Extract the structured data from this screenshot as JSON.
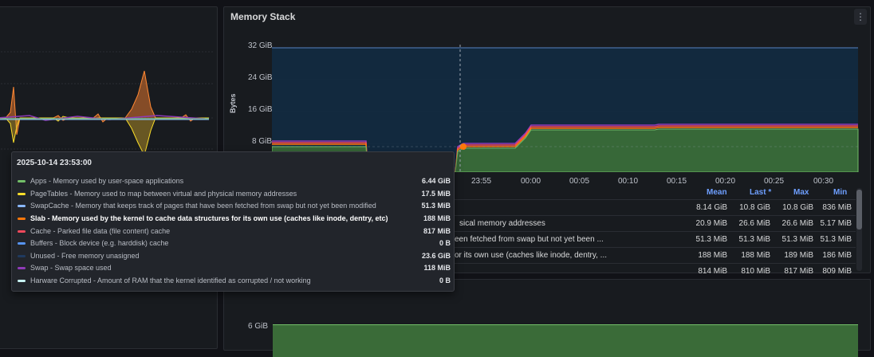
{
  "panels": {
    "memory_stack": {
      "title": "Memory Stack",
      "menu_icon": "⋮"
    }
  },
  "chart_data": {
    "type": "area",
    "ylabel": "Bytes",
    "y_ticks": [
      "32 GiB",
      "24 GiB",
      "16 GiB",
      "8 GiB"
    ],
    "x_ticks": [
      "23:55",
      "00:00",
      "00:05",
      "00:10",
      "00:15",
      "00:20",
      "00:25",
      "00:30"
    ],
    "ylim_gib": [
      0,
      32
    ],
    "legend_placement": "bottom",
    "legend_headers": [
      "Mean",
      "Last *",
      "Max",
      "Min"
    ],
    "series": [
      {
        "name": "Apps - Memory used by user-space applications",
        "color": "#73bf69"
      },
      {
        "name": "PageTables - Memory used to map between virtual and physical memory addresses",
        "color": "#fade2a"
      },
      {
        "name": "SwapCache - Memory that keeps track of pages that have been fetched from swap but not yet been modified",
        "color": "#5794f2"
      },
      {
        "name": "Slab - Memory used by the kernel to cache data structures for its own use (caches like inode, dentry, etc)",
        "color": "#ff780a"
      },
      {
        "name": "Cache - Parked file data (file content) cache",
        "color": "#f2495c"
      },
      {
        "name": "Buffers - Block device (e.g. harddisk) cache",
        "color": "#5794f2"
      },
      {
        "name": "Unused - Free memory unasigned",
        "color": "#1f3a5f"
      },
      {
        "name": "Swap - Swap space used",
        "color": "#8f3bb8"
      },
      {
        "name": "Harware Corrupted - Amount of RAM that the kernel identified as corrupted / not working",
        "color": "#c8f2f2"
      }
    ]
  },
  "legend_rows": [
    {
      "name": "",
      "mean": "8.14 GiB",
      "last": "10.8 GiB",
      "max": "10.8 GiB",
      "min": "836 MiB"
    },
    {
      "name": "sical memory addresses",
      "mean": "20.9 MiB",
      "last": "26.6 MiB",
      "max": "26.6 MiB",
      "min": "5.17 MiB"
    },
    {
      "name": "een fetched from swap but not yet been ...",
      "mean": "51.3 MiB",
      "last": "51.3 MiB",
      "max": "51.3 MiB",
      "min": "51.3 MiB"
    },
    {
      "name": "or its own use (caches like inode, dentry, ...",
      "mean": "188 MiB",
      "last": "188 MiB",
      "max": "189 MiB",
      "min": "186 MiB"
    },
    {
      "name": "",
      "mean": "814 MiB",
      "last": "810 MiB",
      "max": "817 MiB",
      "min": "809 MiB"
    }
  ],
  "lower_panel": {
    "y_tick": "6 GiB"
  },
  "tooltip": {
    "timestamp": "2025-10-14 23:53:00",
    "rows": [
      {
        "label": "Apps - Memory used by user-space applications",
        "value": "6.44 GiB",
        "color": "#73bf69"
      },
      {
        "label": "PageTables - Memory used to map between virtual and physical memory addresses",
        "value": "17.5 MiB",
        "color": "#fade2a"
      },
      {
        "label": "SwapCache - Memory that keeps track of pages that have been fetched from swap but not yet been modified",
        "value": "51.3 MiB",
        "color": "#8ab8ff"
      },
      {
        "label": "Slab - Memory used by the kernel to cache data structures for its own use (caches like inode, dentry, etc)",
        "value": "188 MiB",
        "color": "#ff780a"
      },
      {
        "label": "Cache - Parked file data (file content) cache",
        "value": "817 MiB",
        "color": "#f2495c"
      },
      {
        "label": "Buffers - Block device (e.g. harddisk) cache",
        "value": "0 B",
        "color": "#5794f2"
      },
      {
        "label": "Unused - Free memory unasigned",
        "value": "23.6 GiB",
        "color": "#1f3a5f"
      },
      {
        "label": "Swap - Swap space used",
        "value": "118 MiB",
        "color": "#8f3bb8"
      },
      {
        "label": "Harware Corrupted - Amount of RAM that the kernel identified as corrupted / not working",
        "value": "0 B",
        "color": "#c8f2f2"
      }
    ]
  }
}
